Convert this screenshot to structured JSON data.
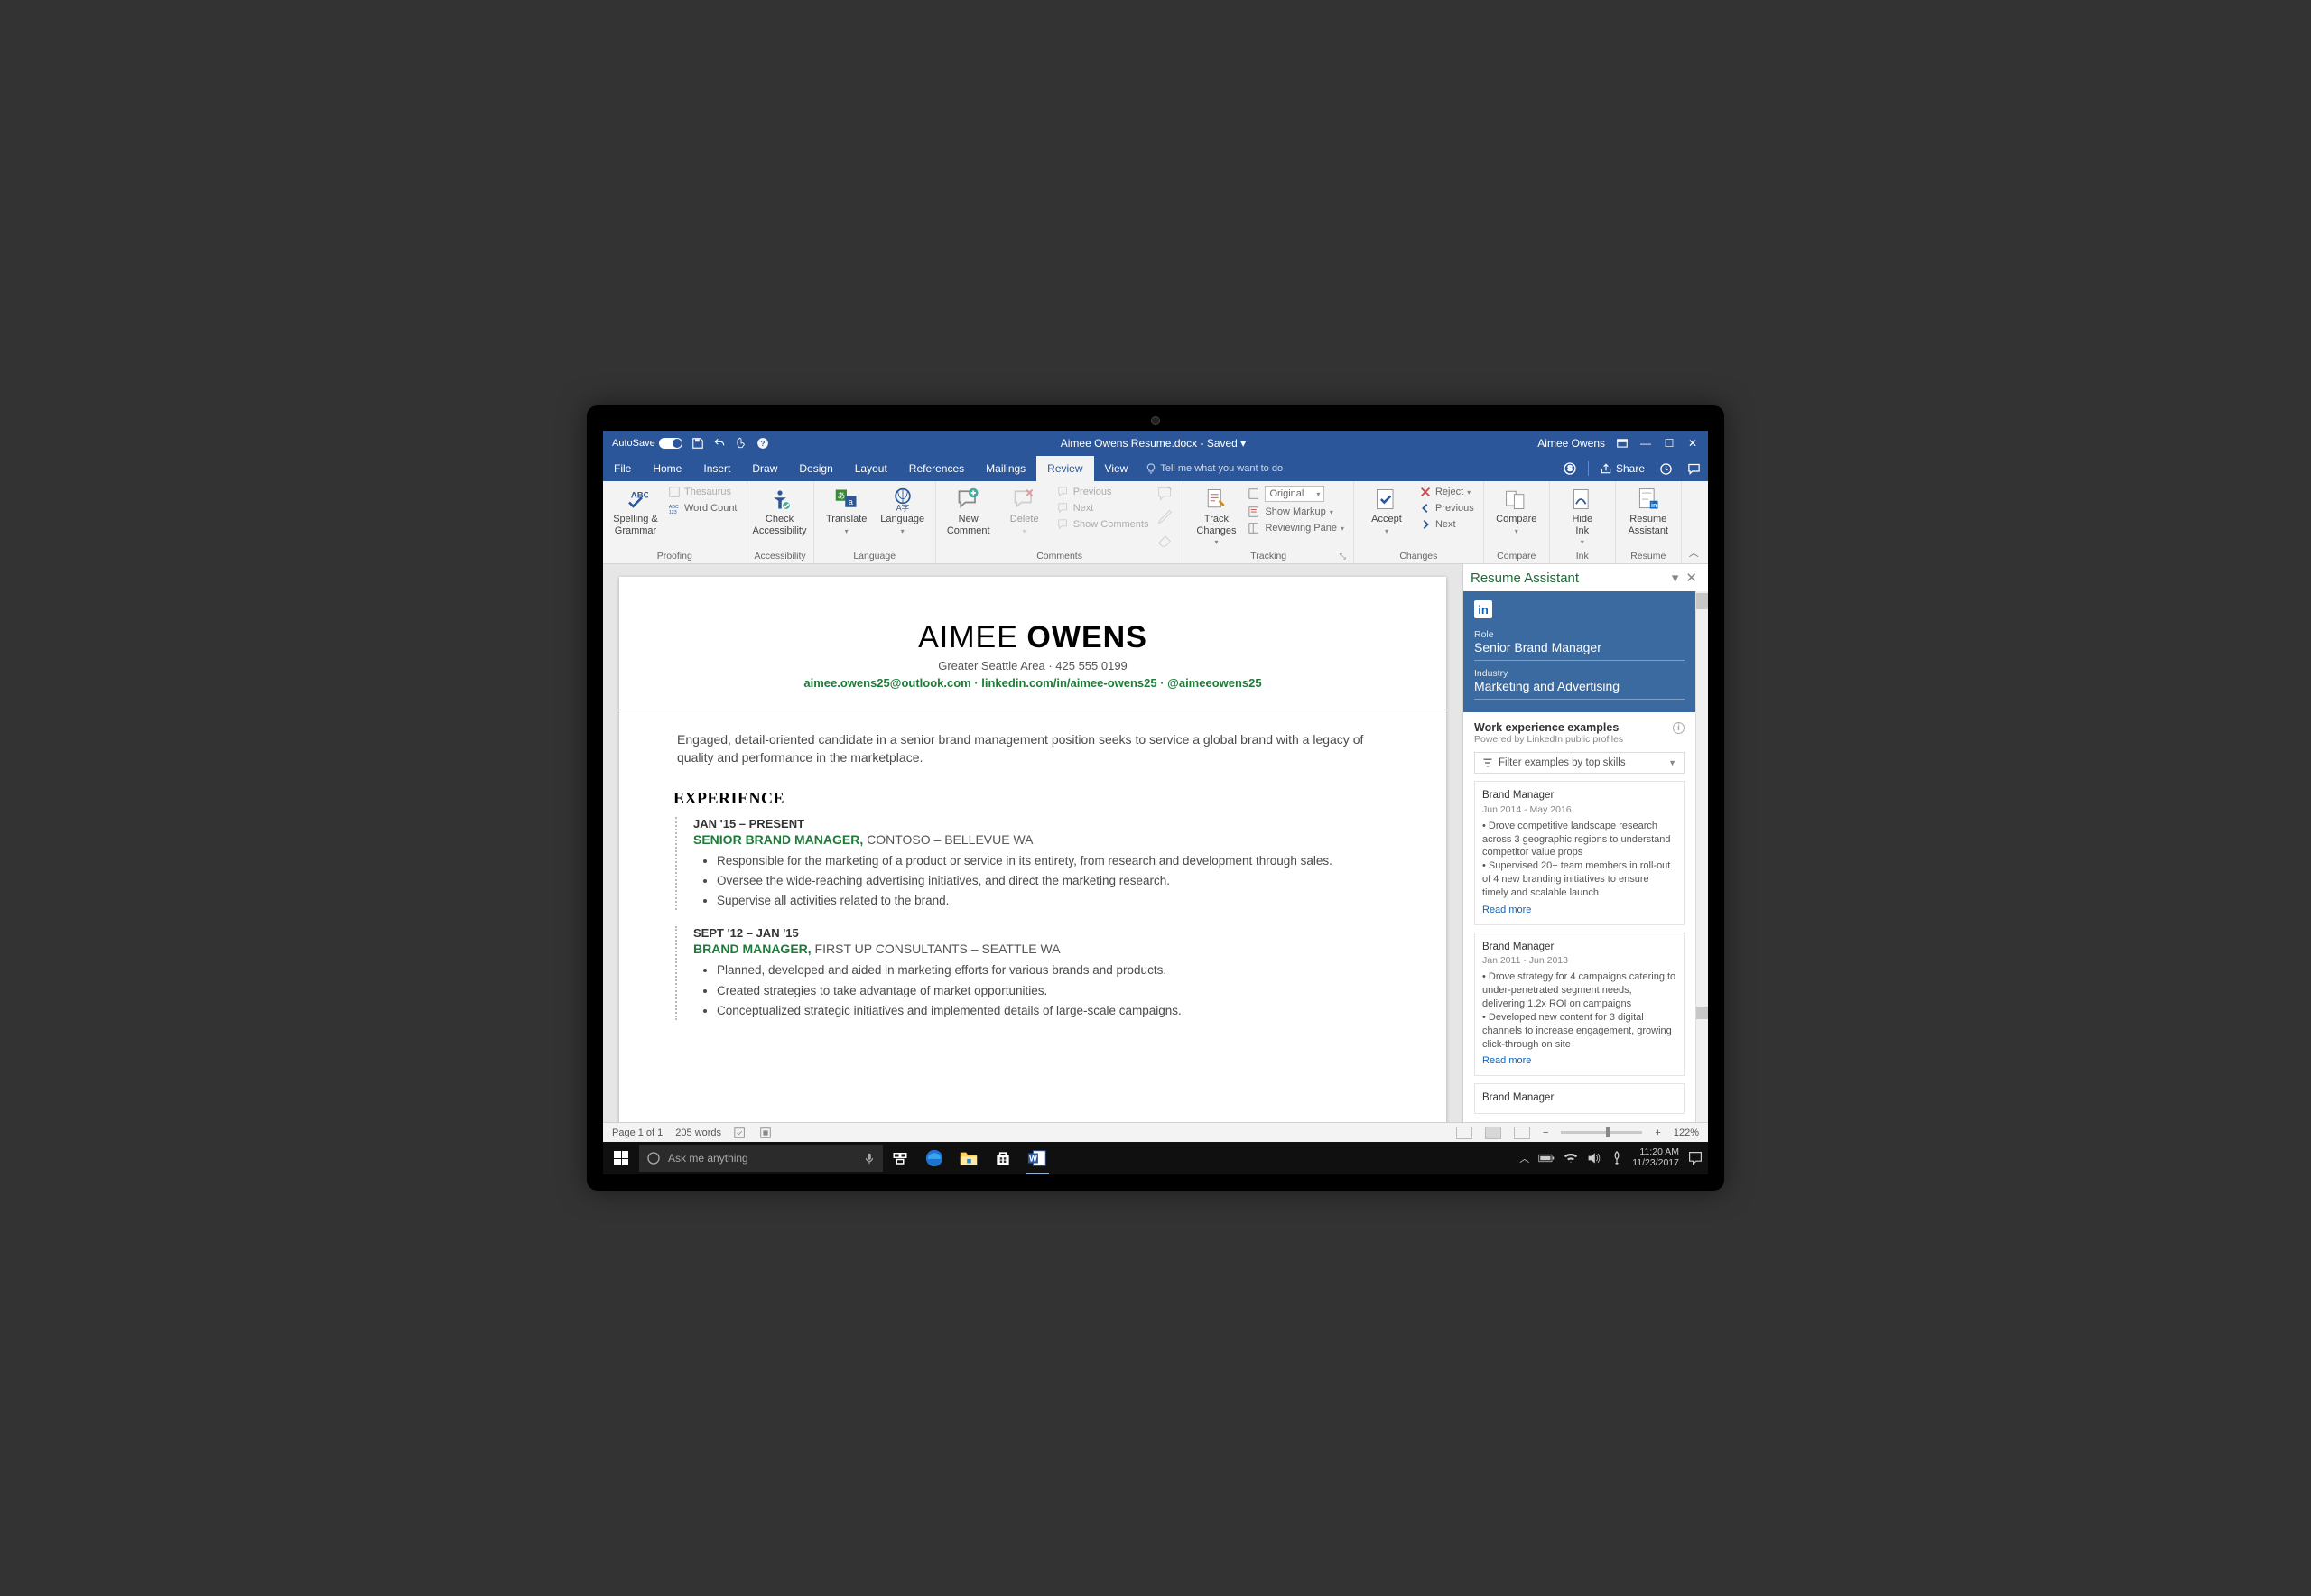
{
  "titlebar": {
    "autosave_label": "AutoSave",
    "autosave_state": "On",
    "doc_title": "Aimee Owens Resume.docx - Saved ▾",
    "user": "Aimee Owens"
  },
  "menu": {
    "tabs": [
      "File",
      "Home",
      "Insert",
      "Draw",
      "Design",
      "Layout",
      "References",
      "Mailings",
      "Review",
      "View"
    ],
    "active": "Review",
    "tell_me": "Tell me what you want to do",
    "share": "Share"
  },
  "ribbon": {
    "proofing": {
      "label": "Proofing",
      "spelling": "Spelling &\nGrammar",
      "thesaurus": "Thesaurus",
      "wordcount": "Word Count"
    },
    "accessibility": {
      "label": "Accessibility",
      "check": "Check\nAccessibility"
    },
    "language": {
      "label": "Language",
      "translate": "Translate",
      "lang": "Language"
    },
    "comments": {
      "label": "Comments",
      "new": "New\nComment",
      "delete": "Delete",
      "previous": "Previous",
      "next": "Next",
      "show": "Show Comments"
    },
    "tracking": {
      "label": "Tracking",
      "track": "Track\nChanges",
      "display_mode": "Original",
      "markup": "Show Markup",
      "pane": "Reviewing Pane"
    },
    "changes": {
      "label": "Changes",
      "accept": "Accept",
      "reject": "Reject",
      "previous": "Previous",
      "next": "Next"
    },
    "compare": {
      "label": "Compare",
      "compare": "Compare"
    },
    "ink": {
      "label": "Ink",
      "hide": "Hide\nInk"
    },
    "resume": {
      "label": "Resume",
      "assistant": "Resume\nAssistant"
    }
  },
  "doc": {
    "first": "AIMEE",
    "last": "OWENS",
    "subtitle": "Greater Seattle Area  ·  425 555 0199",
    "links": "aimee.owens25@outlook.com · linkedin.com/in/aimee-owens25 · @aimeeowens25",
    "summary": "Engaged, detail-oriented candidate in a senior brand management position seeks to service a global brand with a legacy of quality and performance in the marketplace.",
    "exp_h": "EXPERIENCE",
    "jobs": [
      {
        "dates": "JAN '15 – PRESENT",
        "title": "SENIOR BRAND MANAGER,",
        "company": " CONTOSO – BELLEVUE WA",
        "bullets": [
          "Responsible for the marketing of a product or service in its entirety, from research and development through sales.",
          "Oversee the wide-reaching advertising initiatives, and direct the marketing research.",
          "Supervise all activities related to the brand."
        ]
      },
      {
        "dates": "SEPT '12 – JAN '15",
        "title": "BRAND MANAGER,",
        "company": " FIRST UP CONSULTANTS – SEATTLE WA",
        "bullets": [
          "Planned, developed and aided in marketing efforts for various brands and products.",
          "Created strategies to take advantage of market opportunities.",
          "Conceptualized strategic initiatives and implemented details of large-scale campaigns."
        ]
      }
    ]
  },
  "pane": {
    "title": "Resume Assistant",
    "role_label": "Role",
    "role": "Senior Brand Manager",
    "industry_label": "Industry",
    "industry": "Marketing and Advertising",
    "section_h": "Work experience examples",
    "powered": "Powered by LinkedIn public profiles",
    "filter": "Filter examples by top skills",
    "examples": [
      {
        "title": "Brand Manager",
        "dates": "Jun 2014 - May 2016",
        "lines": [
          "• Drove competitive landscape research across 3 geographic regions to understand competitor value props",
          "• Supervised 20+ team members in roll-out of 4 new branding initiatives to ensure timely and scalable launch"
        ],
        "more": "Read more"
      },
      {
        "title": "Brand Manager",
        "dates": "Jan 2011 - Jun 2013",
        "lines": [
          "• Drove strategy for 4 campaigns catering to under-penetrated segment needs, delivering 1.2x ROI on campaigns",
          "• Developed new content for 3 digital channels to increase engagement, growing click-through on site"
        ],
        "more": "Read more"
      },
      {
        "title": "Brand Manager",
        "dates": "",
        "lines": [],
        "more": ""
      }
    ]
  },
  "status": {
    "page": "Page 1 of 1",
    "words": "205 words",
    "zoom": "122%"
  },
  "taskbar": {
    "search": "Ask me anything",
    "time": "11:20 AM",
    "date": "11/23/2017"
  }
}
